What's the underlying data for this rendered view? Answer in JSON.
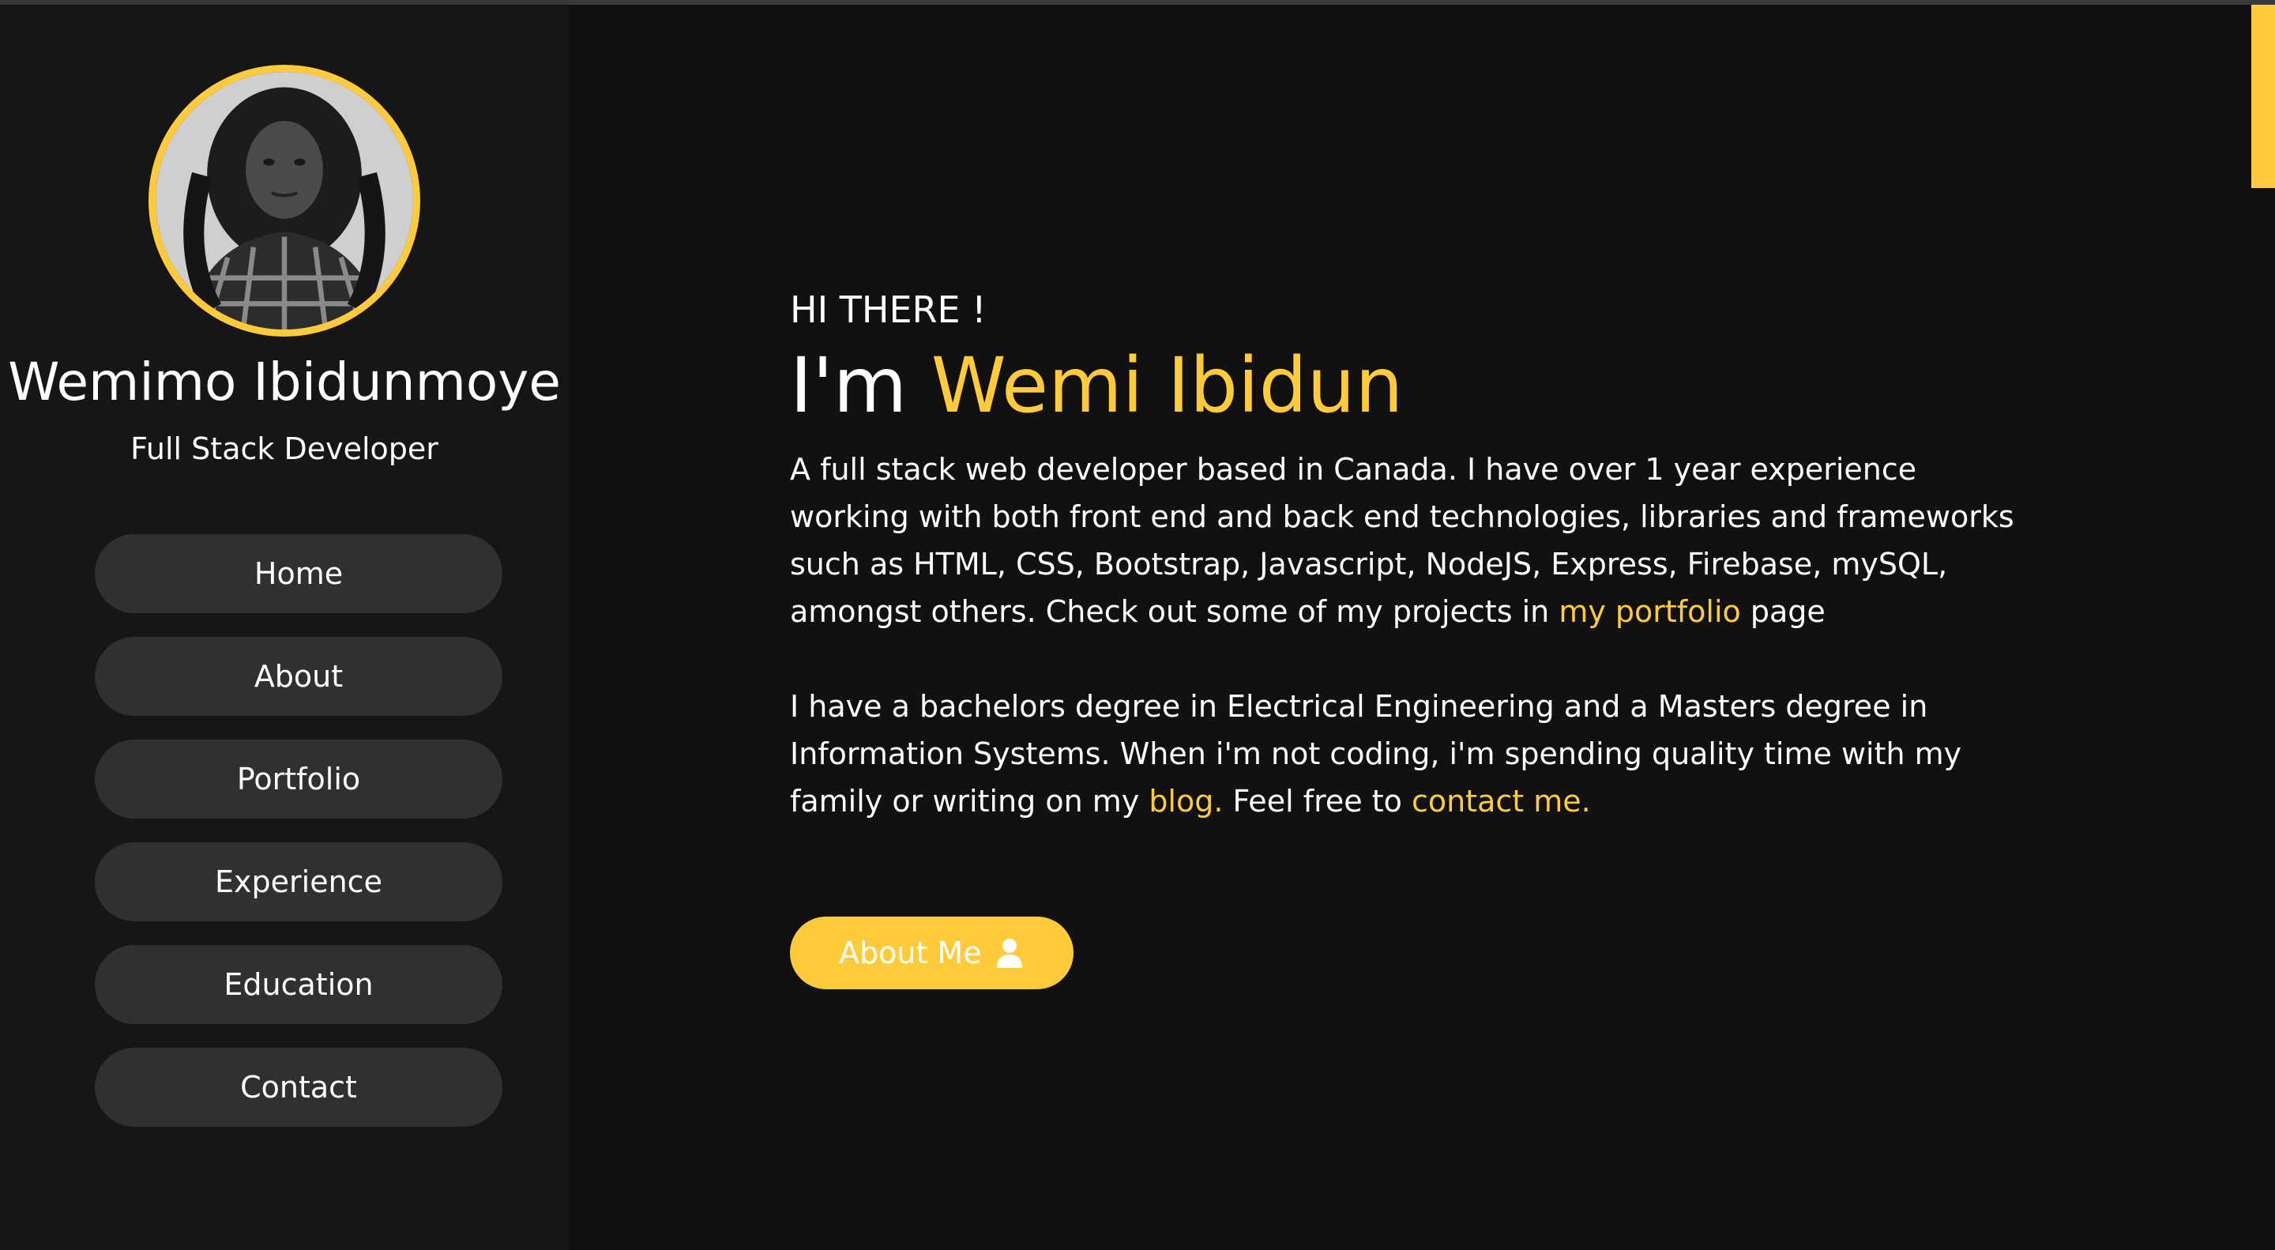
{
  "profile": {
    "name": "Wemimo Ibidunmoye",
    "role": "Full Stack Developer",
    "avatar_icon": "profile-photo"
  },
  "nav": {
    "items": [
      {
        "label": "Home"
      },
      {
        "label": "About"
      },
      {
        "label": "Portfolio"
      },
      {
        "label": "Experience"
      },
      {
        "label": "Education"
      },
      {
        "label": "Contact"
      }
    ]
  },
  "hero": {
    "greeting": "HI THERE !",
    "headline_prefix": "I'm ",
    "headline_name": "Wemi Ibidun",
    "para1_text": "A full stack web developer based in Canada. I have over 1 year experience working with both front end and back end technologies, libraries and frameworks such as HTML, CSS, Bootstrap, Javascript, NodeJS, Express, Firebase, mySQL, amongst others. Check out some of my projects in ",
    "para1_link": "my portfolio",
    "para1_end": " page",
    "para2_text": "I have a bachelors degree in Electrical Engineering and a Masters degree in Information Systems. When i'm not coding, i'm spending quality time with my family or writing on my ",
    "para2_link_blog": "blog.",
    "para2_mid": " Feel free to ",
    "para2_link_contact": "contact me.",
    "button_label": "About Me",
    "button_icon": "user-icon"
  },
  "colors": {
    "accent": "#ffcb3a",
    "background": "#111111",
    "sidebar": "#161616",
    "nav_button": "#303030"
  }
}
